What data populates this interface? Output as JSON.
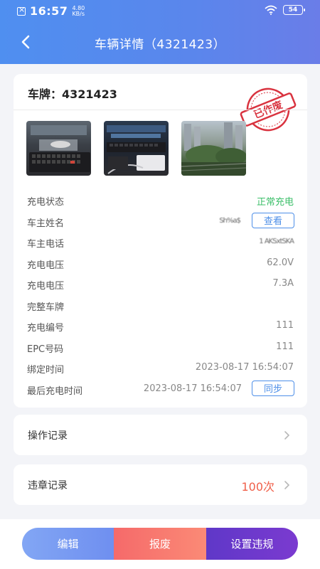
{
  "status_bar": {
    "time": "16:57",
    "speed_value": "4.80",
    "speed_unit": "KB/s",
    "battery": "54"
  },
  "nav": {
    "title": "车辆详情（4321423）"
  },
  "vehicle": {
    "plate": "车牌：4321423",
    "stamp_text": "已作废"
  },
  "details": [
    {
      "label": "充电状态",
      "value": "正常充电"
    },
    {
      "label": "车主姓名",
      "value": "Sh%a$"
    },
    {
      "label": "车主电话",
      "value": "1 AKSxtSKA"
    },
    {
      "label": "充电电压",
      "value": "62.0V"
    },
    {
      "label": "充电电压",
      "value": "7.3A"
    },
    {
      "label": "完整车牌",
      "value": ""
    },
    {
      "label": "充电编号",
      "value": "111"
    },
    {
      "label": "EPC号码",
      "value": "111"
    },
    {
      "label": "绑定时间",
      "value": "2023-08-17 16:54:07"
    },
    {
      "label": "最后充电时间",
      "value": "2023-08-17 16:54:07"
    }
  ],
  "buttons": {
    "view": "查看",
    "sync": "同步",
    "edit": "编辑",
    "scrap": "报废",
    "set_violation": "设置违规"
  },
  "operation_record": {
    "label": "操作记录"
  },
  "violation_record": {
    "label": "违章记录",
    "value": "100次"
  },
  "colors": {
    "accent": "#4e8fe8",
    "status_green": "#3cbf6a",
    "violation_red": "#f0604a",
    "stamp_red": "#d9333f"
  }
}
